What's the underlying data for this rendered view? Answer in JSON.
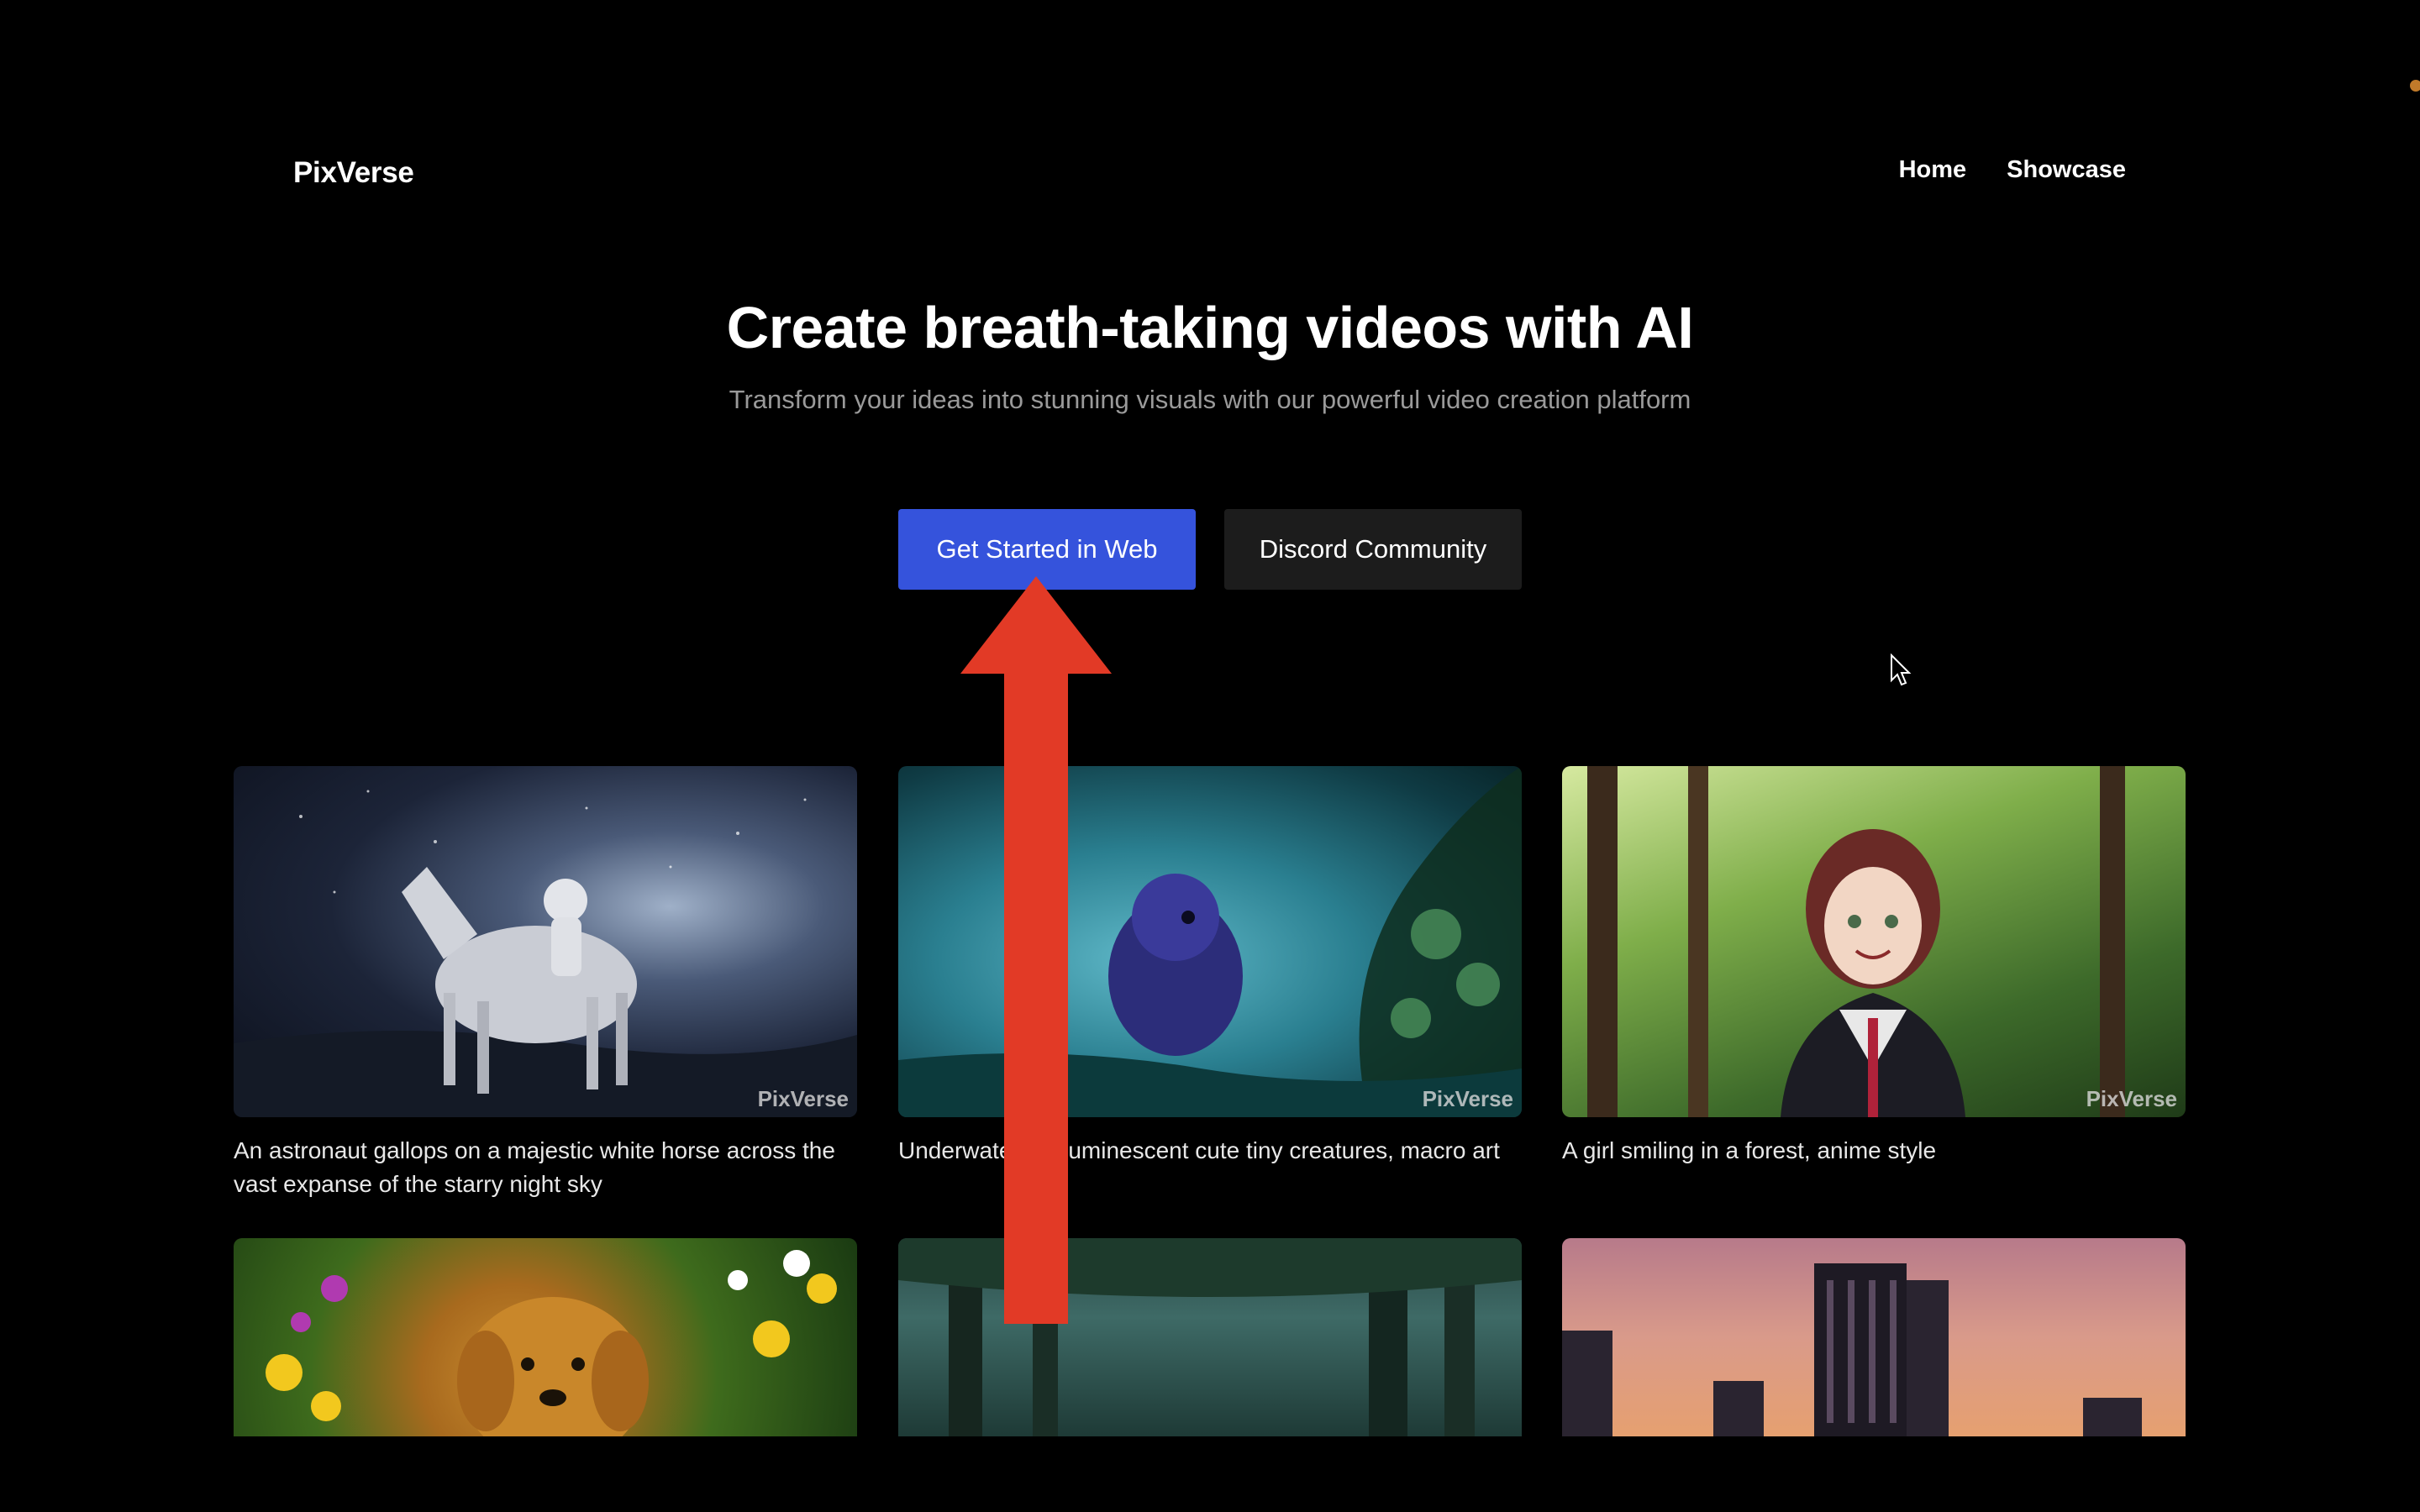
{
  "header": {
    "logo": "PixVerse",
    "nav": [
      "Home",
      "Showcase"
    ]
  },
  "hero": {
    "title": "Create breath-taking videos with AI",
    "subtitle": "Transform your ideas into stunning visuals with our powerful video creation platform"
  },
  "buttons": {
    "primary": "Get Started in Web",
    "secondary": "Discord Community"
  },
  "watermark": "PixVerse",
  "gallery": [
    {
      "caption": "An astronaut gallops on a majestic white horse across the vast expanse of the starry night sky"
    },
    {
      "caption": "Underwater, bioluminescent cute tiny creatures, macro art"
    },
    {
      "caption": "A girl smiling in a forest, anime style"
    },
    {
      "caption": ""
    },
    {
      "caption": ""
    },
    {
      "caption": ""
    }
  ],
  "colors": {
    "background": "#000000",
    "primary_button": "#3553dc",
    "secondary_button": "#1c1c1c",
    "annotation_arrow": "#e23a26"
  },
  "icons": {
    "cursor": "mouse-pointer-icon",
    "annotation": "red-up-arrow-icon"
  }
}
